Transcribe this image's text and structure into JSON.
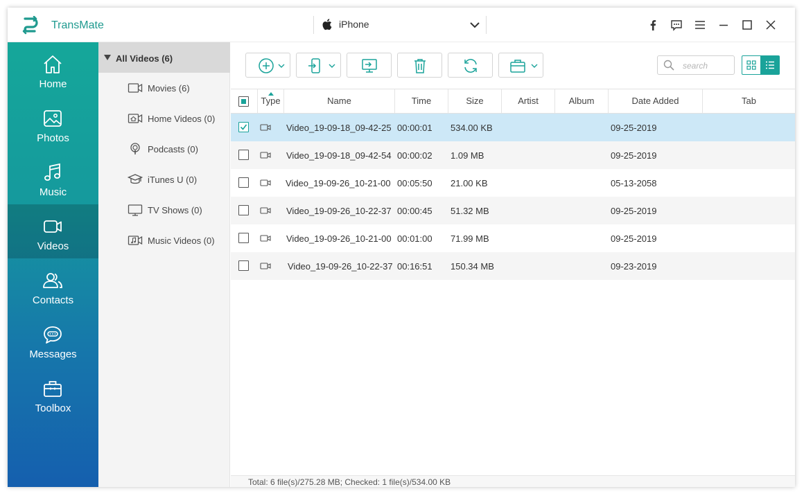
{
  "app": {
    "title": "TransMate"
  },
  "device": {
    "name": "iPhone"
  },
  "titlebar_icons": [
    "facebook-icon",
    "feedback-icon",
    "menu-icon",
    "minimize-icon",
    "maximize-icon",
    "close-icon"
  ],
  "sidebar": {
    "items": [
      {
        "label": "Home",
        "icon": "home-icon"
      },
      {
        "label": "Photos",
        "icon": "photo-icon"
      },
      {
        "label": "Music",
        "icon": "music-icon"
      },
      {
        "label": "Videos",
        "icon": "video-icon",
        "active": true
      },
      {
        "label": "Contacts",
        "icon": "contacts-icon"
      },
      {
        "label": "Messages",
        "icon": "messages-icon"
      },
      {
        "label": "Toolbox",
        "icon": "toolbox-icon"
      }
    ]
  },
  "categories": {
    "header": "All Videos (6)",
    "items": [
      {
        "label": "Movies (6)",
        "icon": "movie-icon"
      },
      {
        "label": "Home Videos (0)",
        "icon": "home-video-icon"
      },
      {
        "label": "Podcasts (0)",
        "icon": "podcast-icon"
      },
      {
        "label": "iTunes U (0)",
        "icon": "itunes-u-icon"
      },
      {
        "label": "TV Shows (0)",
        "icon": "tv-icon"
      },
      {
        "label": "Music Videos (0)",
        "icon": "music-video-icon"
      }
    ]
  },
  "toolbar": {
    "search_placeholder": "search",
    "buttons": [
      "add-icon",
      "export-to-device-icon",
      "export-to-pc-icon",
      "delete-icon",
      "refresh-icon",
      "toolbox-icon"
    ]
  },
  "table": {
    "columns": [
      "Type",
      "Name",
      "Time",
      "Size",
      "Artist",
      "Album",
      "Date Added",
      "Tab"
    ],
    "rows": [
      {
        "name": "Video_19-09-18_09-42-25",
        "time": "00:00:01",
        "size": "534.00 KB",
        "artist": "",
        "album": "",
        "date": "09-25-2019",
        "checked": true
      },
      {
        "name": "Video_19-09-18_09-42-54",
        "time": "00:00:02",
        "size": "1.09 MB",
        "artist": "",
        "album": "",
        "date": "09-25-2019",
        "checked": false
      },
      {
        "name": "Video_19-09-26_10-21-00",
        "time": "00:05:50",
        "size": "21.00 KB",
        "artist": "",
        "album": "",
        "date": "05-13-2058",
        "checked": false
      },
      {
        "name": "Video_19-09-26_10-22-37",
        "time": "00:00:45",
        "size": "51.32 MB",
        "artist": "",
        "album": "",
        "date": "09-25-2019",
        "checked": false
      },
      {
        "name": "Video_19-09-26_10-21-00",
        "time": "00:01:00",
        "size": "71.99 MB",
        "artist": "",
        "album": "",
        "date": "09-25-2019",
        "checked": false
      },
      {
        "name": "Video_19-09-26_10-22-37",
        "time": "00:16:51",
        "size": "150.34 MB",
        "artist": "",
        "album": "",
        "date": "09-23-2019",
        "checked": false
      }
    ]
  },
  "status": {
    "text": "Total: 6 file(s)/275.28 MB; Checked: 1 file(s)/534.00 KB"
  },
  "colors": {
    "accent": "#1aa39a",
    "selected_row": "#cde8f7",
    "brand_text": "#1f9a8f"
  }
}
